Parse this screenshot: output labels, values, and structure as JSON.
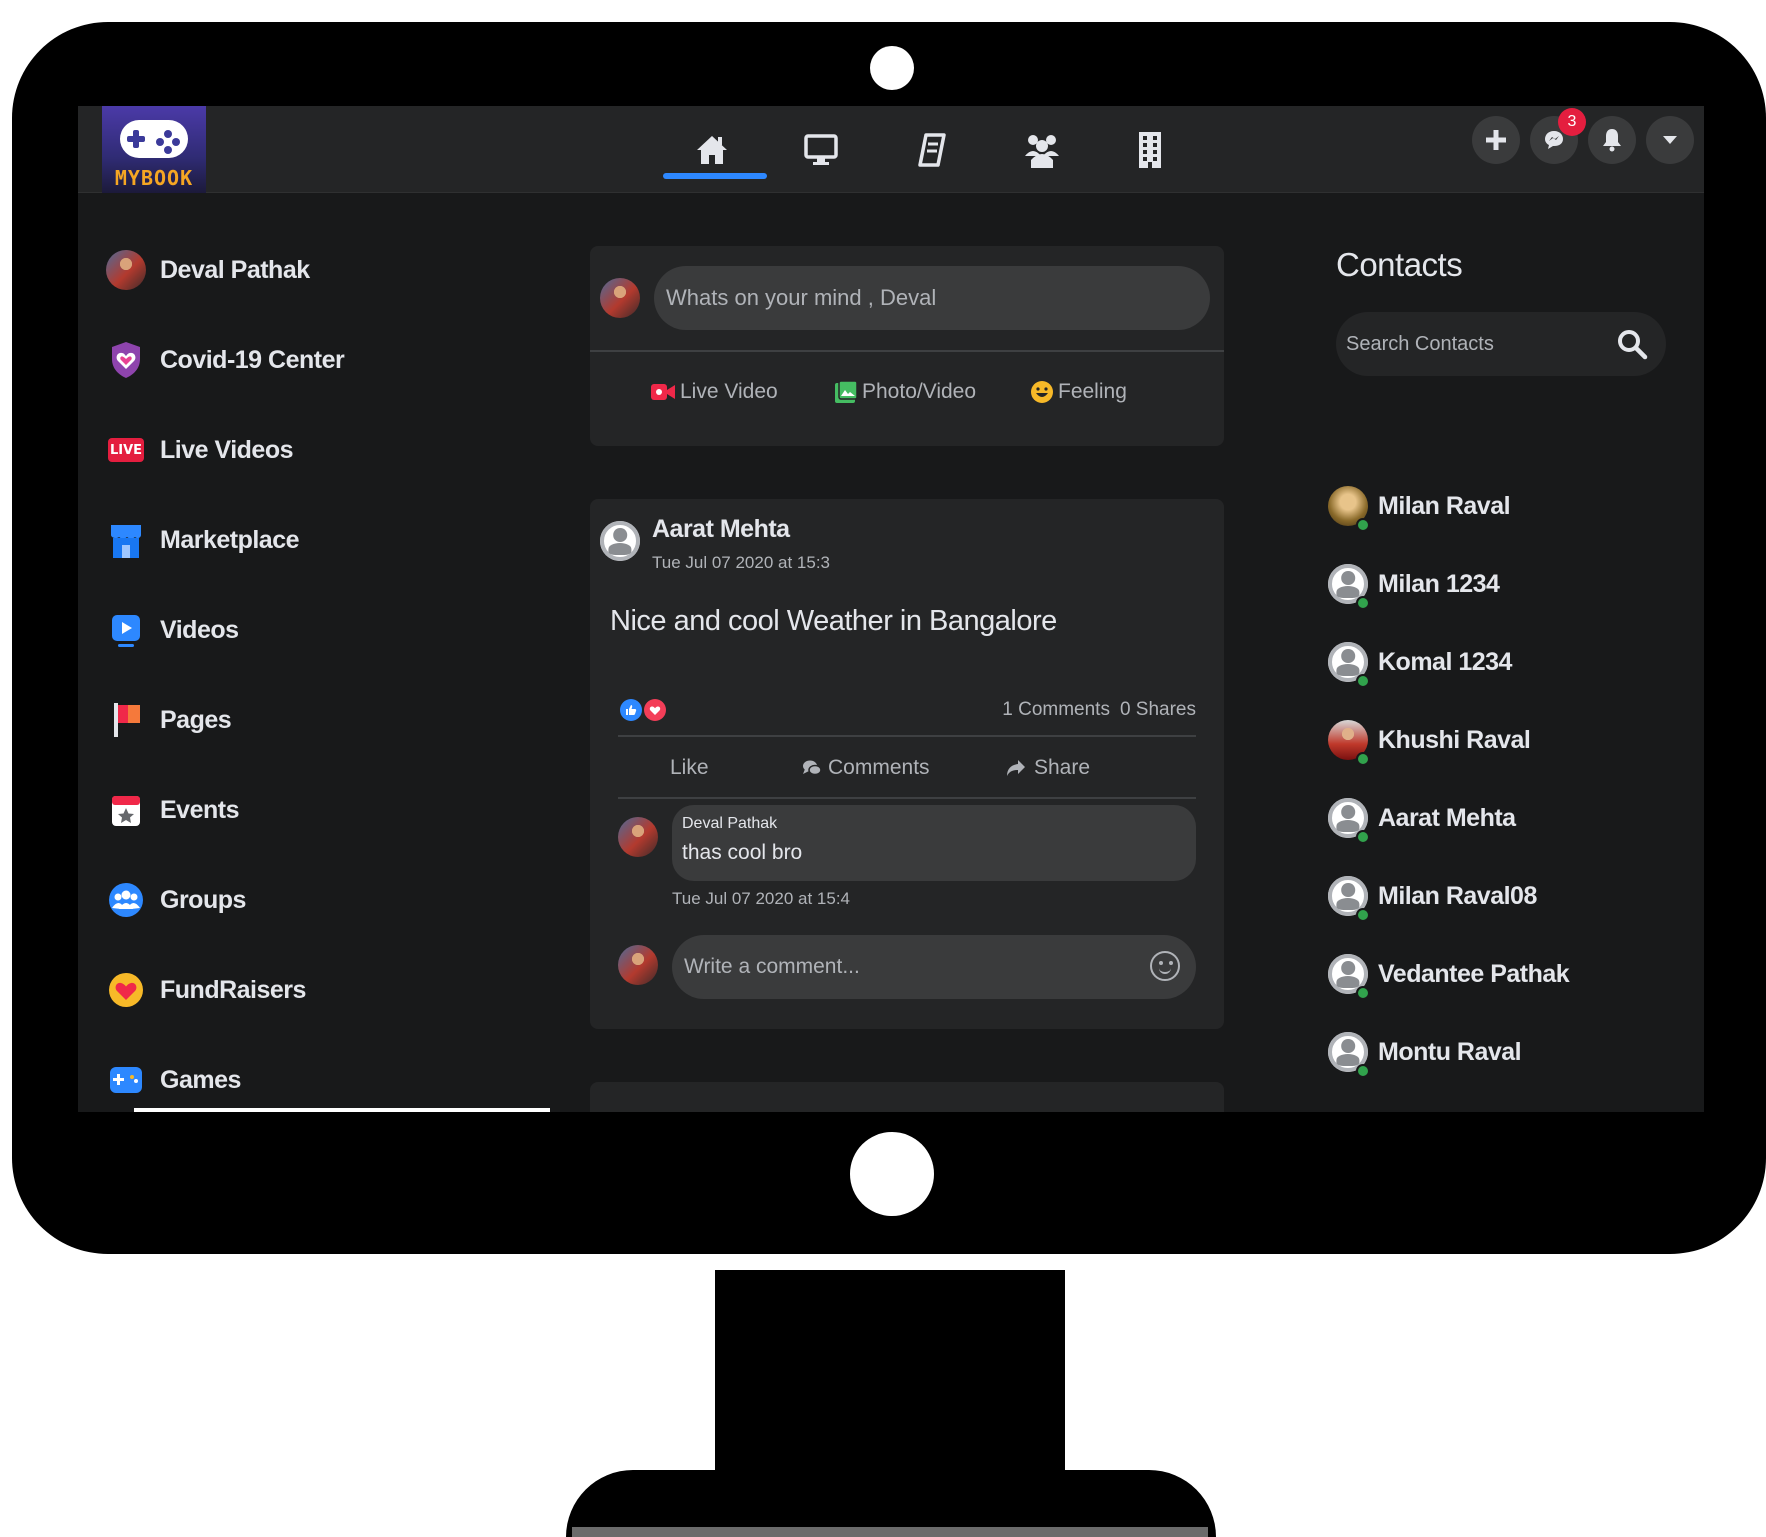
{
  "app": {
    "logo_text": "MYBOOK"
  },
  "header": {
    "nav": [
      "home-icon",
      "monitor-icon",
      "news-icon",
      "friends-icon",
      "building-icon"
    ],
    "actions": [
      "plus-icon",
      "messenger-icon",
      "bell-icon",
      "caret-down-icon"
    ],
    "messenger_badge": "3",
    "accent": "#2d88ff"
  },
  "sidebar": {
    "items": [
      {
        "label": "Deval Pathak",
        "icon": "profile-avatar"
      },
      {
        "label": "Covid-19 Center",
        "icon": "shield-heart-icon"
      },
      {
        "label": "Live Videos",
        "icon": "live-icon"
      },
      {
        "label": "Marketplace",
        "icon": "shop-icon"
      },
      {
        "label": "Videos",
        "icon": "play-icon"
      },
      {
        "label": "Pages",
        "icon": "flag-icon"
      },
      {
        "label": "Events",
        "icon": "calendar-star-icon"
      },
      {
        "label": "Groups",
        "icon": "people-icon"
      },
      {
        "label": "FundRaisers",
        "icon": "heart-coin-icon"
      },
      {
        "label": "Games",
        "icon": "gamepad-icon"
      }
    ],
    "live_badge_text": "LIVE"
  },
  "composer": {
    "placeholder": "Whats on your mind , Deval",
    "actions": [
      "Live Video",
      "Photo/Video",
      "Feeling"
    ]
  },
  "post": {
    "author": "Aarat Mehta",
    "time": "Tue Jul 07 2020 at 15:3",
    "text": "Nice and cool Weather in Bangalore",
    "comments_count": "1 Comments",
    "shares_count": "0 Shares",
    "actions": [
      "Like",
      "Comments",
      "Share"
    ],
    "comment": {
      "author": "Deval Pathak",
      "text": "thas cool bro",
      "time": "Tue Jul 07 2020 at 15:4"
    },
    "comment_placeholder": "Write a comment..."
  },
  "contacts": {
    "title": "Contacts",
    "search_placeholder": "Search Contacts",
    "list": [
      {
        "name": "Milan Raval",
        "avatar": "photo-gold"
      },
      {
        "name": "Milan 1234",
        "avatar": "default"
      },
      {
        "name": "Komal 1234",
        "avatar": "default"
      },
      {
        "name": "Khushi Raval",
        "avatar": "photo-red"
      },
      {
        "name": "Aarat Mehta",
        "avatar": "default"
      },
      {
        "name": "Milan Raval08",
        "avatar": "default"
      },
      {
        "name": "Vedantee Pathak",
        "avatar": "default"
      },
      {
        "name": "Montu Raval",
        "avatar": "default"
      }
    ],
    "online_color": "#31a24c"
  }
}
